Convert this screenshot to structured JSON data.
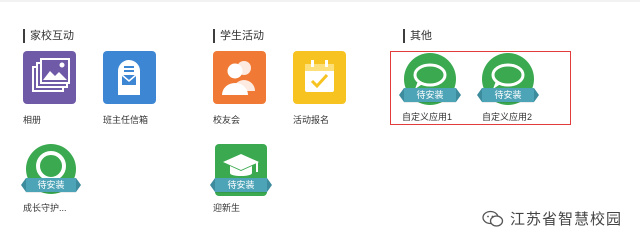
{
  "sections": {
    "home_school": "家校互动",
    "student_activity": "学生活动",
    "other": "其他"
  },
  "apps": {
    "album": {
      "label": "相册",
      "icon": "album-icon",
      "color": "#6f5aa8"
    },
    "mailbox": {
      "label": "班主任信箱",
      "icon": "mailbox-icon",
      "color": "#3d86d4"
    },
    "alumni": {
      "label": "校友会",
      "icon": "people-icon",
      "color": "#f07a35"
    },
    "signup": {
      "label": "活动报名",
      "icon": "calendar-check-icon",
      "color": "#f6c321"
    },
    "custom1": {
      "label": "自定义应用1",
      "icon": "chat-bubble-icon",
      "color": "#3aa94f",
      "badge": "待安装"
    },
    "custom2": {
      "label": "自定义应用2",
      "icon": "chat-bubble-icon",
      "color": "#3aa94f",
      "badge": "待安装"
    },
    "guardian": {
      "label": "成长守护...",
      "icon": "ring-icon",
      "color": "#3aa94f",
      "badge": "待安装"
    },
    "freshman": {
      "label": "迎新生",
      "icon": "graduation-cap-icon",
      "color": "#3aa94f",
      "badge": "待安装"
    }
  },
  "watermark": {
    "text": "江苏省智慧校园",
    "icon": "wechat-icon"
  }
}
